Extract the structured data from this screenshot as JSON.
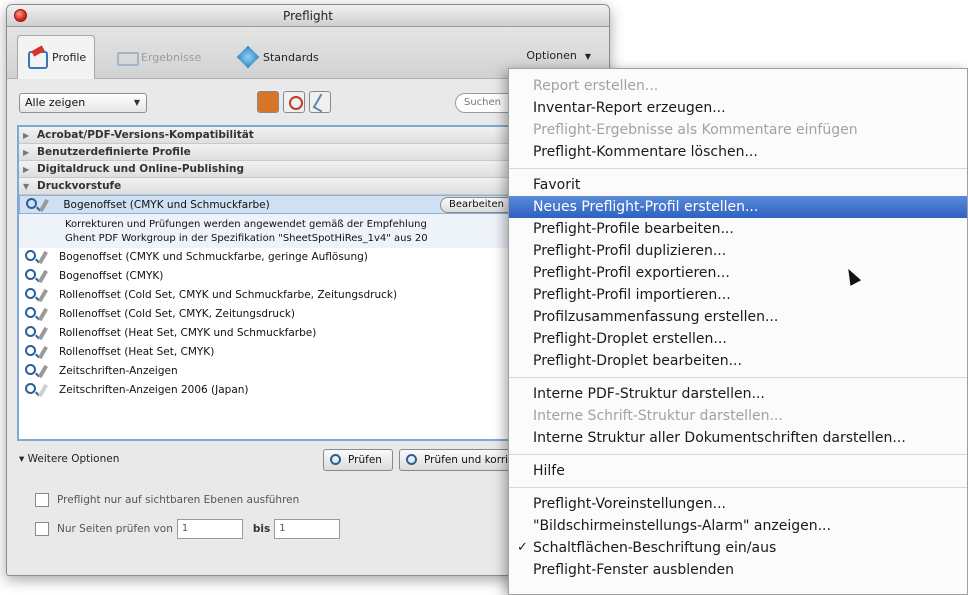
{
  "window": {
    "title": "Preflight"
  },
  "tabs": [
    {
      "label": "Profile",
      "icon": "profile-icon",
      "state": "active"
    },
    {
      "label": "Ergebnisse",
      "icon": "results-icon",
      "state": "disabled"
    },
    {
      "label": "Standards",
      "icon": "standards-icon",
      "state": "normal"
    }
  ],
  "optionen": {
    "label": "Optionen"
  },
  "filter": {
    "selected": "Alle zeigen"
  },
  "search": {
    "placeholder": "Suchen"
  },
  "list": {
    "groups": [
      "Acrobat/PDF-Versions-Kompatibilität",
      "Benutzerdefinierte Profile",
      "Digitaldruck und Online-Publishing",
      "Druckvorstufe"
    ],
    "selected_profile": "Bogenoffset (CMYK und Schmuckfarbe)",
    "edit_button": "Bearbeiten",
    "description_line1": "Korrekturen und Prüfungen werden angewendet gemäß der Empfehlung",
    "description_line2": "Ghent PDF Workgroup in der Spezifikation \"SheetSpotHiRes_1v4\" aus 20",
    "profiles": [
      "Bogenoffset (CMYK und Schmuckfarbe, geringe Auflösung)",
      "Bogenoffset (CMYK)",
      "Rollenoffset (Cold Set, CMYK und Schmuckfarbe, Zeitungsdruck)",
      "Rollenoffset (Cold Set, CMYK, Zeitungsdruck)",
      "Rollenoffset (Heat Set, CMYK und Schmuckfarbe)",
      "Rollenoffset (Heat Set, CMYK)",
      "Zeitschriften-Anzeigen",
      "Zeitschriften-Anzeigen 2006 (Japan)"
    ]
  },
  "bottom": {
    "weitere": "Weitere Optionen",
    "pruefen": "Prüfen",
    "pruefen_und": "Prüfen und korrigieren",
    "chk1": "Preflight nur auf sichtbaren Ebenen ausführen",
    "chk2": "Nur Seiten prüfen von",
    "from": "1",
    "bis": "bis",
    "to": "1"
  },
  "menu": {
    "items": [
      {
        "label": "Report erstellen...",
        "disabled": true
      },
      {
        "label": "Inventar-Report erzeugen...",
        "disabled": false
      },
      {
        "label": "Preflight-Ergebnisse als Kommentare einfügen",
        "disabled": true
      },
      {
        "label": "Preflight-Kommentare löschen...",
        "disabled": false
      },
      {
        "separator": true
      },
      {
        "label": "Favorit",
        "disabled": false
      },
      {
        "label": "Neues Preflight-Profil erstellen...",
        "highlighted": true
      },
      {
        "label": "Preflight-Profile bearbeiten...",
        "disabled": false
      },
      {
        "label": "Preflight-Profil duplizieren...",
        "disabled": false
      },
      {
        "label": "Preflight-Profil exportieren...",
        "disabled": false
      },
      {
        "label": "Preflight-Profil importieren...",
        "disabled": false
      },
      {
        "label": "Profilzusammenfassung erstellen...",
        "disabled": false
      },
      {
        "label": "Preflight-Droplet erstellen...",
        "disabled": false
      },
      {
        "label": "Preflight-Droplet bearbeiten...",
        "disabled": false
      },
      {
        "separator": true
      },
      {
        "label": "Interne PDF-Struktur darstellen...",
        "disabled": false
      },
      {
        "label": "Interne Schrift-Struktur darstellen...",
        "disabled": true
      },
      {
        "label": "Interne Struktur aller Dokumentschriften darstellen...",
        "disabled": false
      },
      {
        "separator": true
      },
      {
        "label": "Hilfe",
        "disabled": false
      },
      {
        "separator": true
      },
      {
        "label": "Preflight-Voreinstellungen...",
        "disabled": false
      },
      {
        "label": "\"Bildschirmeinstellungs-Alarm\" anzeigen...",
        "disabled": false
      },
      {
        "label": "Schaltflächen-Beschriftung ein/aus",
        "checked": true
      },
      {
        "label": "Preflight-Fenster ausblenden",
        "disabled": false
      }
    ]
  }
}
